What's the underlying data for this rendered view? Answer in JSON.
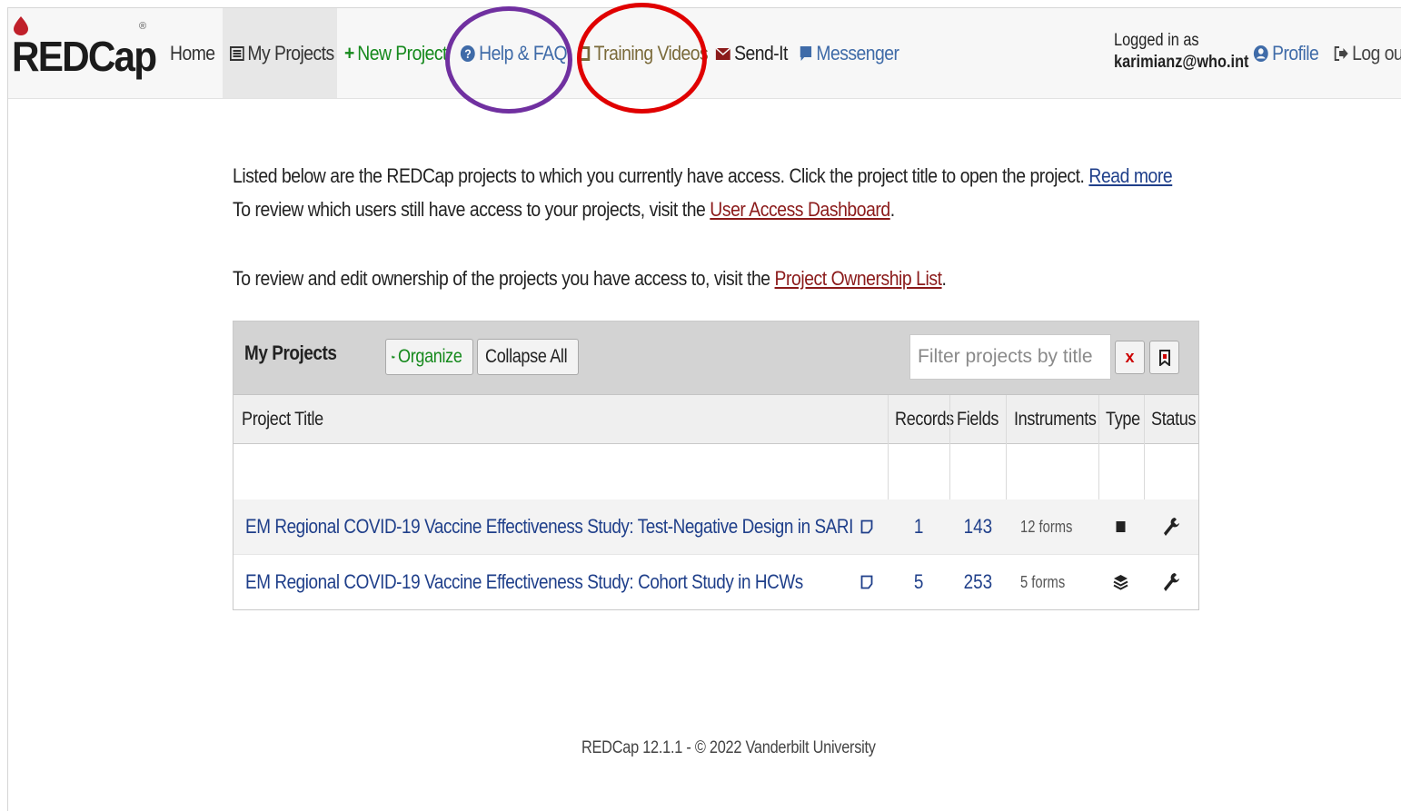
{
  "navbar": {
    "logo_text": "REDCap",
    "logo_mark": "®",
    "items": {
      "home": "Home",
      "my_projects": "My Projects",
      "new_project": "New Project",
      "help": "Help & FAQ",
      "training": "Training Videos",
      "send_it": "Send-It",
      "messenger": "Messenger",
      "profile": "Profile",
      "logout": "Log out"
    },
    "logged_in_label": "Logged in as",
    "user_email": "karimianz@who.int"
  },
  "intro": {
    "text1": "Listed below are the REDCap projects to which you currently have access. Click the project title to open the project.",
    "read_more": "Read more",
    "text2": "To review which users still have access to your projects, visit the",
    "dashboard_link": "User Access Dashboard",
    "text3": ".",
    "ownership_text": "To review and edit ownership of the projects you have access to, visit the",
    "ownership_link": "Project Ownership List",
    "ownership_end": "."
  },
  "panel": {
    "title": "My Projects",
    "organize_label": "Organize",
    "collapse_label": "Collapse All",
    "filter_placeholder": "Filter projects by title",
    "clear_label": "x",
    "columns": {
      "title": "Project Title",
      "records": "Records",
      "fields": "Fields",
      "instruments": "Instruments",
      "type": "Type",
      "status": "Status"
    },
    "rows": [
      {
        "title": "EM Regional COVID-19 Vaccine Effectiveness Study: Test-Negative Design in SARI",
        "records": "1",
        "fields": "143",
        "instruments": "12 forms",
        "type_icon": "square-icon",
        "status_icon": "wrench-icon"
      },
      {
        "title": "EM Regional COVID-19 Vaccine Effectiveness Study: Cohort Study in HCWs",
        "records": "5",
        "fields": "253",
        "instruments": "5 forms",
        "type_icon": "layers-icon",
        "status_icon": "wrench-icon"
      }
    ]
  },
  "footer": {
    "text": "REDCap 12.1.1 - © 2022 Vanderbilt University"
  },
  "colors": {
    "annotation_purple": "#7030a0",
    "annotation_red": "#e00000",
    "link_blue": "#1f3f8a",
    "link_red": "#8b1a1a",
    "new_project_green": "#15891c"
  }
}
